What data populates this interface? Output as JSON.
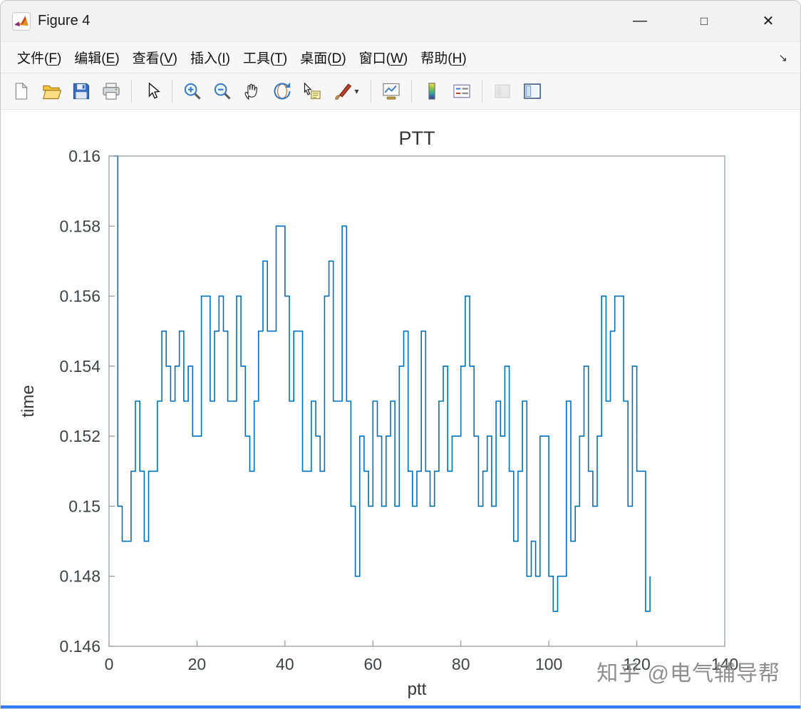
{
  "titlebar": {
    "title": "Figure 4",
    "controls": {
      "minimize": "—",
      "maximize": "□",
      "close": "✕"
    }
  },
  "menubar": {
    "items": [
      {
        "name": "file",
        "label": "文件",
        "accel": "F"
      },
      {
        "name": "edit",
        "label": "编辑",
        "accel": "E"
      },
      {
        "name": "view",
        "label": "查看",
        "accel": "V"
      },
      {
        "name": "insert",
        "label": "插入",
        "accel": "I"
      },
      {
        "name": "tools",
        "label": "工具",
        "accel": "T"
      },
      {
        "name": "desktop",
        "label": "桌面",
        "accel": "D"
      },
      {
        "name": "window",
        "label": "窗口",
        "accel": "W"
      },
      {
        "name": "help",
        "label": "帮助",
        "accel": "H"
      }
    ],
    "dock_arrow": "↘"
  },
  "toolbar": {
    "dropdown_caret": "▾",
    "groups": [
      [
        {
          "name": "new-figure",
          "icon": "new-document-icon"
        },
        {
          "name": "open-file",
          "icon": "open-folder-icon"
        },
        {
          "name": "save-figure",
          "icon": "save-icon"
        },
        {
          "name": "print-figure",
          "icon": "print-icon"
        }
      ],
      [
        {
          "name": "edit-plot",
          "icon": "pointer-icon"
        }
      ],
      [
        {
          "name": "zoom-in",
          "icon": "zoom-in-icon"
        },
        {
          "name": "zoom-out",
          "icon": "zoom-out-icon"
        },
        {
          "name": "pan",
          "icon": "pan-hand-icon"
        },
        {
          "name": "rotate-3d",
          "icon": "rotate-3d-icon"
        },
        {
          "name": "data-cursor",
          "icon": "data-cursor-icon"
        },
        {
          "name": "brush-data",
          "icon": "brush-icon",
          "dropdown": true
        }
      ],
      [
        {
          "name": "link-plot",
          "icon": "link-plot-icon"
        }
      ],
      [
        {
          "name": "insert-colorbar",
          "icon": "colorbar-icon"
        },
        {
          "name": "insert-legend",
          "icon": "legend-icon"
        }
      ],
      [
        {
          "name": "hide-plot-tools",
          "icon": "hide-plot-tools-icon",
          "disabled": true
        },
        {
          "name": "show-plot-tools",
          "icon": "show-plot-tools-icon"
        }
      ]
    ]
  },
  "chart_data": {
    "type": "line",
    "style": "stairs",
    "title": "PTT",
    "xlabel": "ptt",
    "ylabel": "time",
    "xlim": [
      0,
      140
    ],
    "ylim": [
      0.146,
      0.16
    ],
    "xticks": [
      0,
      20,
      40,
      60,
      80,
      100,
      120,
      140
    ],
    "xtick_labels": [
      "0",
      "20",
      "40",
      "60",
      "80",
      "100",
      "120",
      "140"
    ],
    "yticks": [
      0.146,
      0.148,
      0.15,
      0.152,
      0.154,
      0.156,
      0.158,
      0.16
    ],
    "ytick_labels": [
      "0.146",
      "0.148",
      "0.15",
      "0.152",
      "0.154",
      "0.156",
      "0.158",
      "0.16"
    ],
    "grid": false,
    "legend": "none",
    "line_color": "#0072BD",
    "axes_color": "#8e969e",
    "text_color": "#3f4347",
    "x_start": 1,
    "values": [
      0.16,
      0.15,
      0.149,
      0.149,
      0.151,
      0.153,
      0.151,
      0.149,
      0.151,
      0.151,
      0.153,
      0.155,
      0.154,
      0.153,
      0.154,
      0.155,
      0.153,
      0.154,
      0.152,
      0.152,
      0.156,
      0.156,
      0.153,
      0.155,
      0.156,
      0.155,
      0.153,
      0.153,
      0.156,
      0.154,
      0.152,
      0.151,
      0.153,
      0.155,
      0.157,
      0.155,
      0.155,
      0.158,
      0.158,
      0.156,
      0.153,
      0.155,
      0.155,
      0.151,
      0.151,
      0.153,
      0.152,
      0.151,
      0.156,
      0.157,
      0.153,
      0.153,
      0.158,
      0.153,
      0.15,
      0.148,
      0.152,
      0.151,
      0.15,
      0.153,
      0.152,
      0.15,
      0.152,
      0.153,
      0.15,
      0.154,
      0.155,
      0.151,
      0.15,
      0.151,
      0.155,
      0.151,
      0.15,
      0.151,
      0.153,
      0.154,
      0.151,
      0.152,
      0.152,
      0.154,
      0.156,
      0.154,
      0.152,
      0.15,
      0.151,
      0.152,
      0.15,
      0.153,
      0.152,
      0.154,
      0.151,
      0.149,
      0.151,
      0.153,
      0.148,
      0.149,
      0.148,
      0.152,
      0.152,
      0.148,
      0.147,
      0.148,
      0.148,
      0.153,
      0.149,
      0.15,
      0.152,
      0.154,
      0.151,
      0.15,
      0.152,
      0.156,
      0.153,
      0.155,
      0.156,
      0.156,
      0.153,
      0.15,
      0.154,
      0.151,
      0.151,
      0.147,
      0.148
    ]
  },
  "watermark": {
    "text": "知乎 @电气辅导帮"
  },
  "colors": {
    "line_blue": "#0072BD",
    "bottom_strip": "#2e7df6",
    "chrome_gray": "#f2f2f2"
  }
}
